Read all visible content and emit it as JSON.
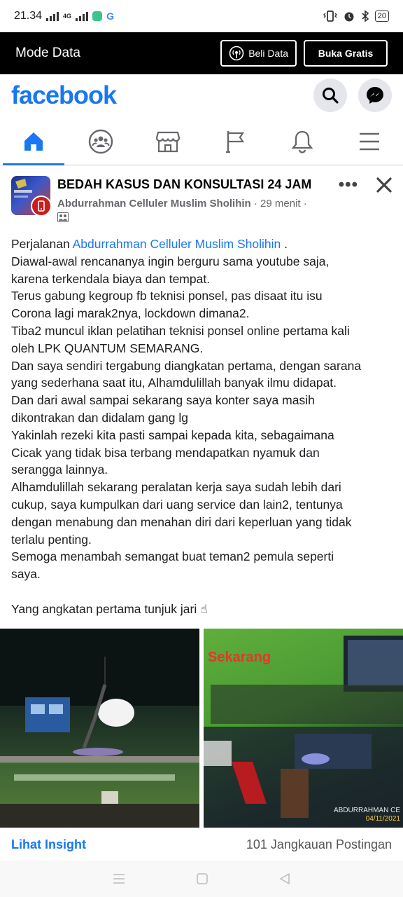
{
  "status_bar": {
    "time": "21.34",
    "network": "4G",
    "battery": "20"
  },
  "mode_bar": {
    "title": "Mode Data",
    "beli_label": "Beli Data",
    "buka_label": "Buka Gratis"
  },
  "header": {
    "logo": "facebook"
  },
  "nav_tabs": [
    "home",
    "groups",
    "marketplace",
    "pages",
    "notifications",
    "menu"
  ],
  "post": {
    "group_name": "BEDAH KASUS DAN KONSULTASI 24 JAM",
    "author": "Abdurrahman Celluler Muslim Sholihin",
    "time_ago": "29 menit",
    "separator": "·",
    "body": {
      "l1_prefix": "Perjalanan ",
      "l1_mention": "Abdurrahman Celluler Muslim Sholihin",
      "l1_suffix": " .",
      "lines": [
        "Diawal-awal rencananya ingin berguru sama youtube saja,",
        "karena terkendala biaya dan tempat.",
        "Terus gabung kegroup fb teknisi ponsel, pas disaat itu isu",
        "Corona lagi marak2nya, lockdown dimana2.",
        "Tiba2 muncul iklan pelatihan teknisi ponsel online pertama kali",
        "oleh LPK QUANTUM SEMARANG.",
        "Dan saya sendiri tergabung diangkatan pertama, dengan sarana",
        "yang sederhana saat itu, Alhamdulillah banyak ilmu didapat.",
        "Dan dari awal sampai sekarang saya konter saya masih",
        "dikontrakan dan didalam gang lg",
        "Yakinlah rezeki kita pasti sampai kepada kita, sebagaimana",
        "Cicak yang tidak bisa terbang mendapatkan nyamuk dan",
        "serangga lainnya.",
        "Alhamdulillah sekarang peralatan kerja saya sudah lebih dari",
        "cukup, saya kumpulkan dari uang service dan lain2, tentunya",
        "dengan menabung dan menahan diri dari keperluan yang tidak",
        "terlalu penting.",
        "Semoga menambah semangat buat teman2 pemula seperti",
        "saya."
      ],
      "closing": "Yang angkatan pertama tunjuk jari ☝"
    },
    "photo_right_caption": "Sekarang",
    "watermark_name": "ABDURRAHMAN CE",
    "watermark_date": "04/11/2021"
  },
  "insight": {
    "link": "Lihat Insight",
    "reach": "101 Jangkauan Postingan"
  },
  "colors": {
    "brand": "#1877f2",
    "mode_bar_bg": "#000000",
    "caption_red": "#e5362b"
  }
}
